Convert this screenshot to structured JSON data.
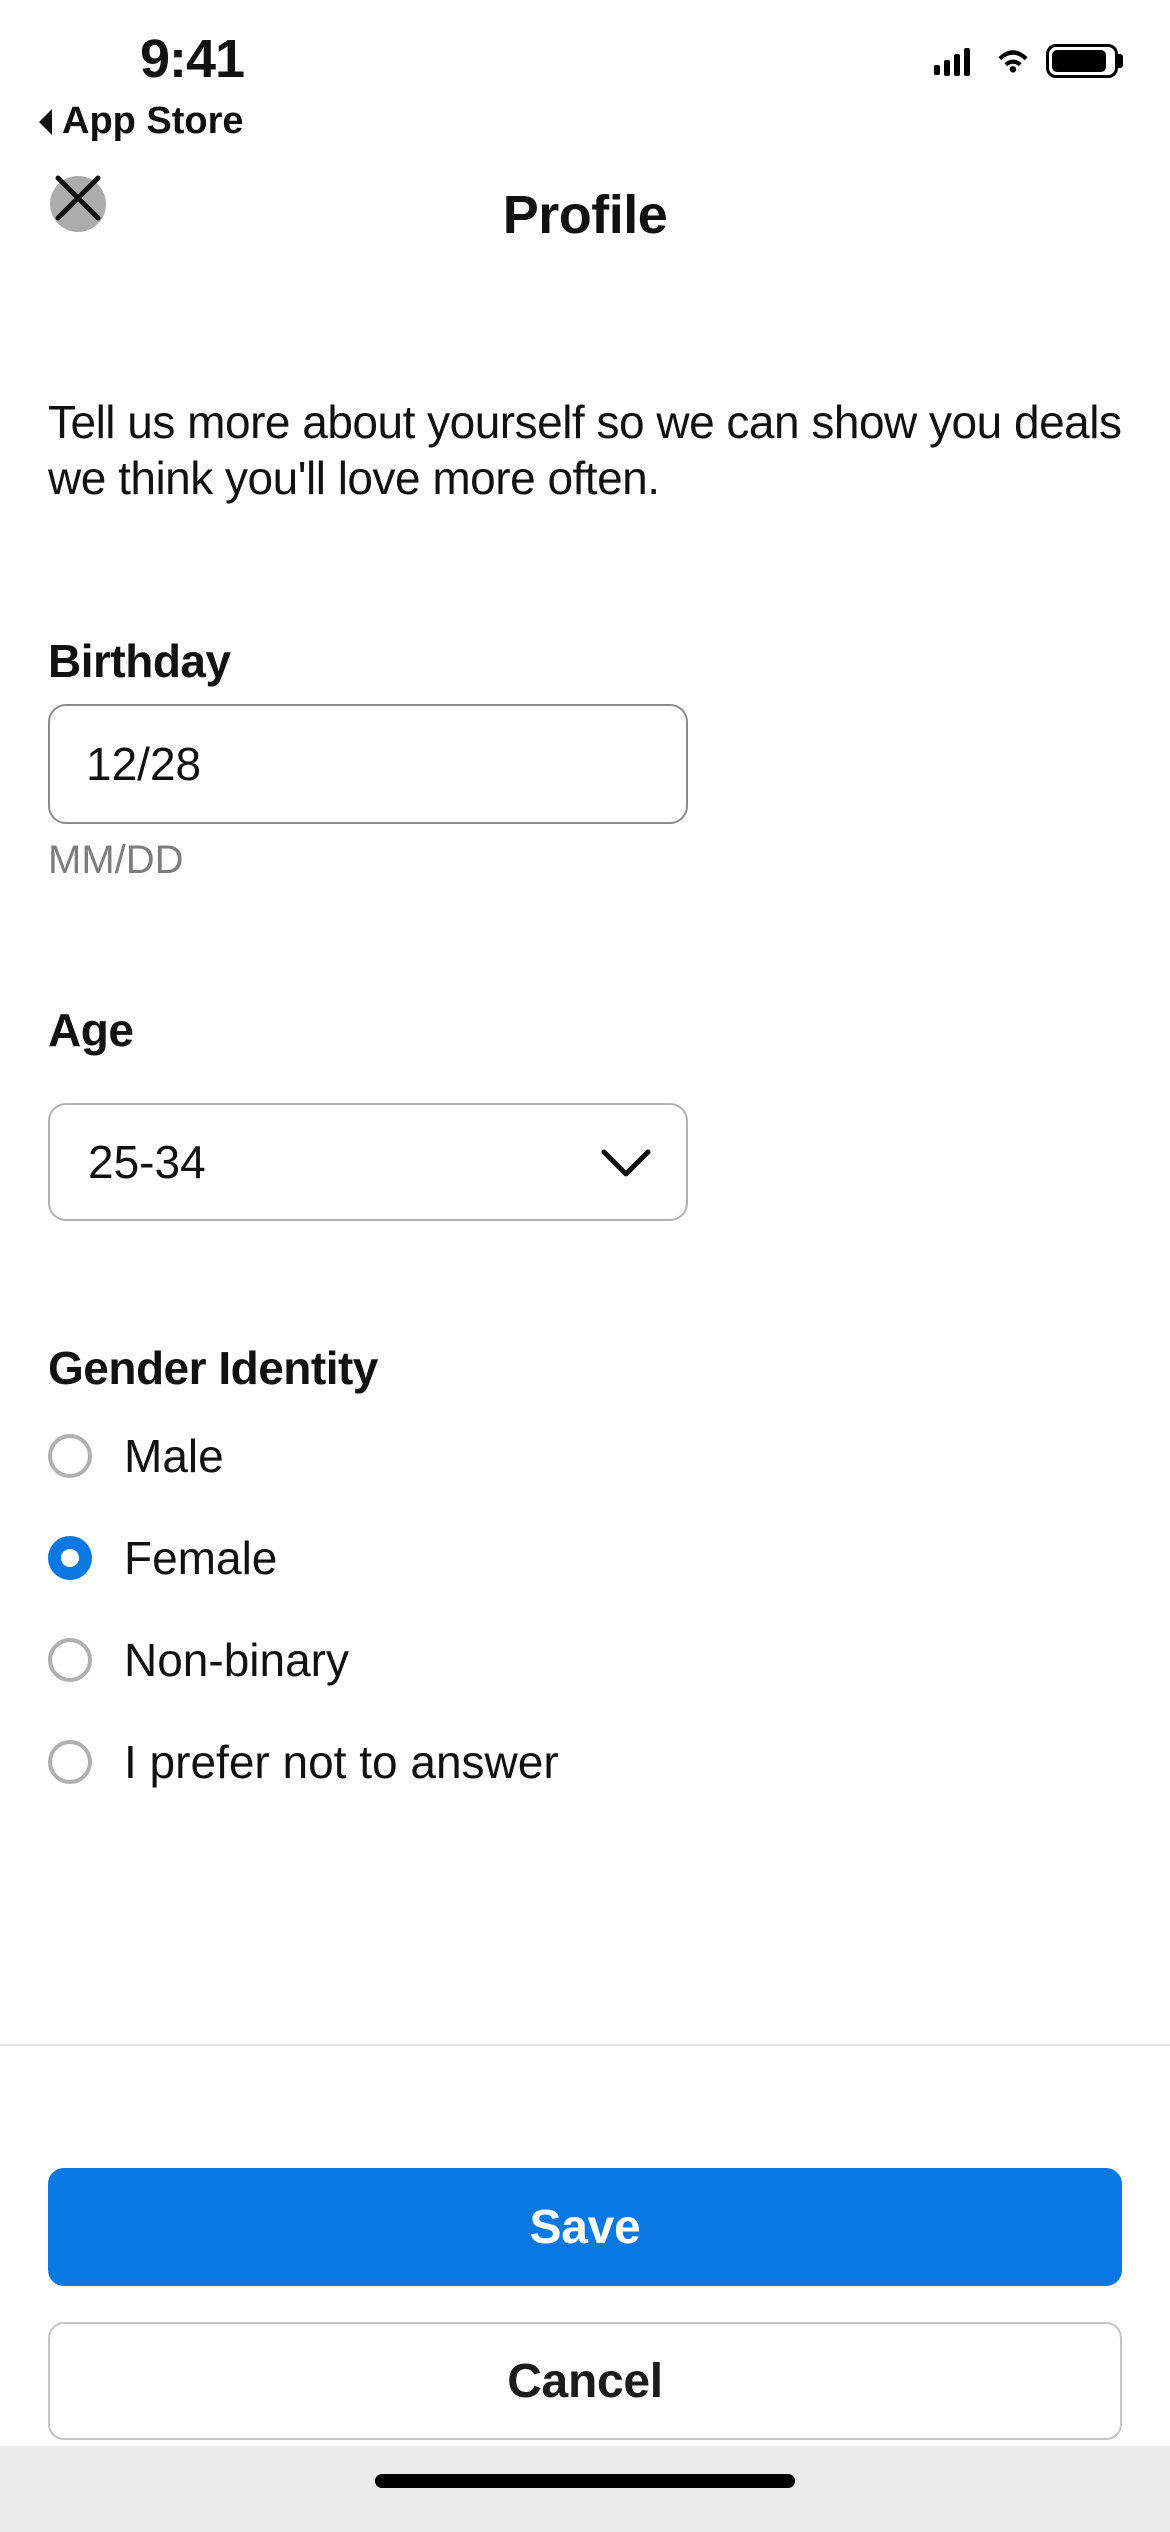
{
  "status": {
    "time": "9:41",
    "back_link": "App Store"
  },
  "header": {
    "title": "Profile"
  },
  "intro": "Tell us more about yourself so we can show you deals we think you'll love more often.",
  "birthday": {
    "label": "Birthday",
    "value": "12/28",
    "hint": "MM/DD"
  },
  "age": {
    "label": "Age",
    "value": "25-34"
  },
  "gender": {
    "label": "Gender Identity",
    "options": [
      {
        "label": "Male",
        "selected": false
      },
      {
        "label": "Female",
        "selected": true
      },
      {
        "label": "Non-binary",
        "selected": false
      },
      {
        "label": "I prefer not to answer",
        "selected": false
      }
    ]
  },
  "footer": {
    "save": "Save",
    "cancel": "Cancel"
  },
  "colors": {
    "accent": "#0a78e3",
    "border": "#b0b0b0"
  }
}
